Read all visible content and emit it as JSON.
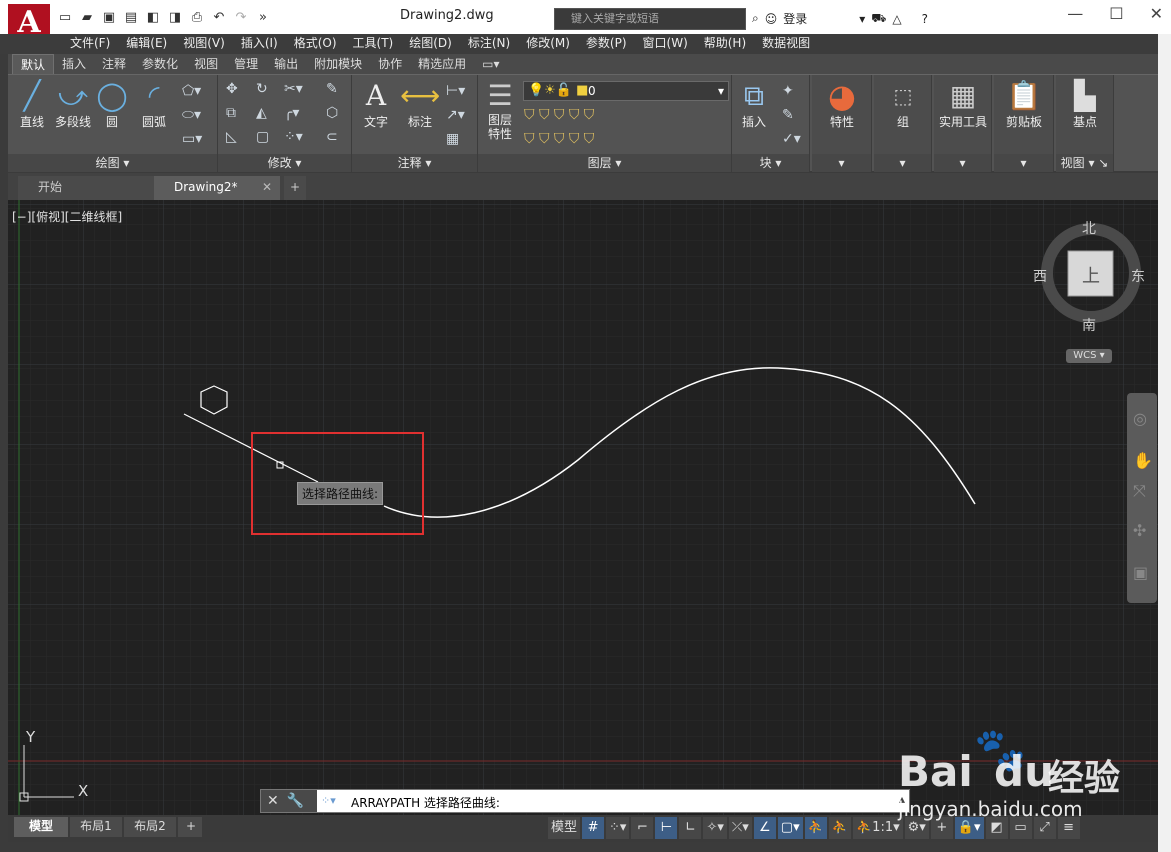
{
  "titlebar": {
    "logo_letter": "A",
    "document_title": "Drawing2.dwg",
    "search_placeholder": "键入关键字或短语",
    "login_label": "登录"
  },
  "menubar": {
    "items": [
      "文件(F)",
      "编辑(E)",
      "视图(V)",
      "插入(I)",
      "格式(O)",
      "工具(T)",
      "绘图(D)",
      "标注(N)",
      "修改(M)",
      "参数(P)",
      "窗口(W)",
      "帮助(H)",
      "数据视图"
    ]
  },
  "ribbon_tabs": {
    "items": [
      "默认",
      "插入",
      "注释",
      "参数化",
      "视图",
      "管理",
      "输出",
      "附加模块",
      "协作",
      "精选应用"
    ],
    "active": "默认"
  },
  "ribbon": {
    "draw": {
      "title": "绘图",
      "line": "直线",
      "polyline": "多段线",
      "circle": "圆",
      "arc": "圆弧"
    },
    "modify": {
      "title": "修改"
    },
    "annotation": {
      "title": "注释",
      "text": "文字",
      "dimension": "标注"
    },
    "layers": {
      "title": "图层",
      "layer_props": "图层\n特性",
      "current_layer": "0"
    },
    "block": {
      "title": "块",
      "insert": "插入"
    },
    "properties": {
      "label": "特性"
    },
    "group": {
      "label": "组"
    },
    "utilities": {
      "label": "实用工具"
    },
    "clipboard": {
      "label": "剪贴板"
    },
    "view": {
      "title": "视图",
      "base": "基点"
    }
  },
  "doc_tabs": {
    "start": "开始",
    "drawing": "Drawing2*",
    "add": "+"
  },
  "viewport": {
    "label": "[−][俯视][二维线框]",
    "prompt_tooltip": "选择路径曲线:",
    "ucs_x": "X",
    "ucs_y": "Y"
  },
  "viewcube": {
    "north": "北",
    "south": "南",
    "east": "东",
    "west": "西",
    "top_face": "上",
    "wcs": "WCS"
  },
  "command_line": {
    "text": "ARRAYPATH 选择路径曲线:"
  },
  "layout_tabs": {
    "model": "模型",
    "layout1": "布局1",
    "layout2": "布局2",
    "add": "+"
  },
  "status": {
    "model_label": "模型",
    "scale": "1:1"
  },
  "watermark": {
    "brand": "Bai",
    "brand2": "du",
    "cn": "经验",
    "url": "jingyan.baidu.com"
  },
  "colors": {
    "highlight_box": "#e03030",
    "canvas_bg": "#212121",
    "curve": "#ffffff"
  }
}
